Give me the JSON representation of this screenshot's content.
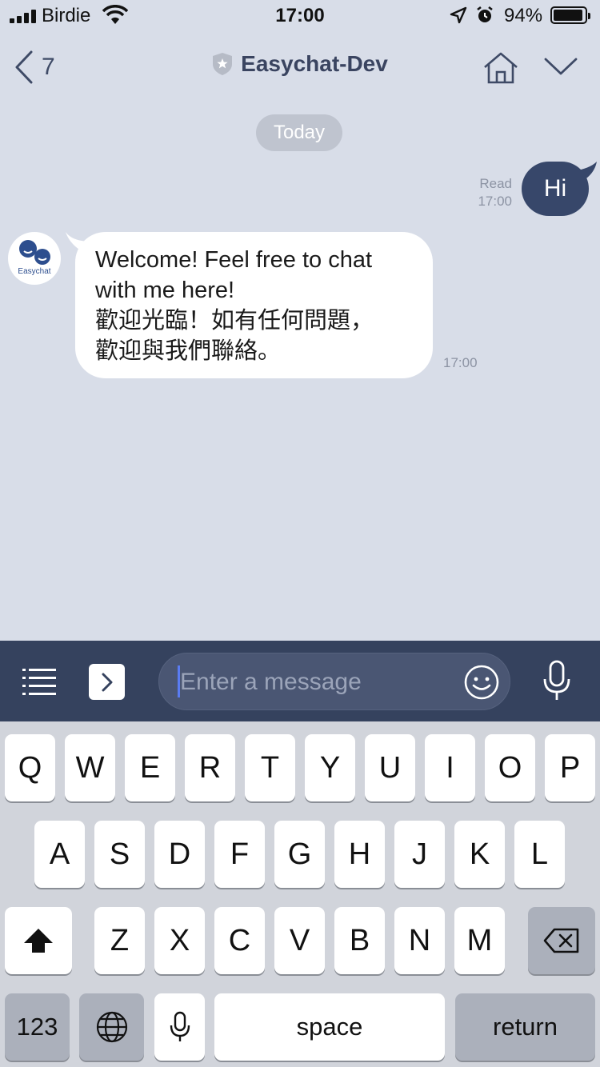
{
  "status_bar": {
    "carrier": "Birdie",
    "time": "17:00",
    "battery": "94%"
  },
  "nav": {
    "back_count": "7",
    "title": "Easychat-Dev"
  },
  "chat": {
    "date_label": "Today",
    "sent": {
      "text": "Hi",
      "read_label": "Read",
      "time": "17:00"
    },
    "received": {
      "avatar_label": "Easychat",
      "lines": [
        "Welcome! Feel free to chat",
        "with me here!",
        "歡迎光臨！如有任何問題，",
        "歡迎與我們聯絡。"
      ],
      "time": "17:00"
    }
  },
  "input_bar": {
    "placeholder": "Enter a message"
  },
  "keyboard": {
    "row1": [
      "Q",
      "W",
      "E",
      "R",
      "T",
      "Y",
      "U",
      "I",
      "O",
      "P"
    ],
    "row2": [
      "A",
      "S",
      "D",
      "F",
      "G",
      "H",
      "J",
      "K",
      "L"
    ],
    "row3": [
      "Z",
      "X",
      "C",
      "V",
      "B",
      "N",
      "M"
    ],
    "numbers_label": "123",
    "space_label": "space",
    "return_label": "return"
  },
  "colors": {
    "background": "#d8dde8",
    "accent_dark": "#35425e",
    "sent_bubble": "#37476a"
  }
}
